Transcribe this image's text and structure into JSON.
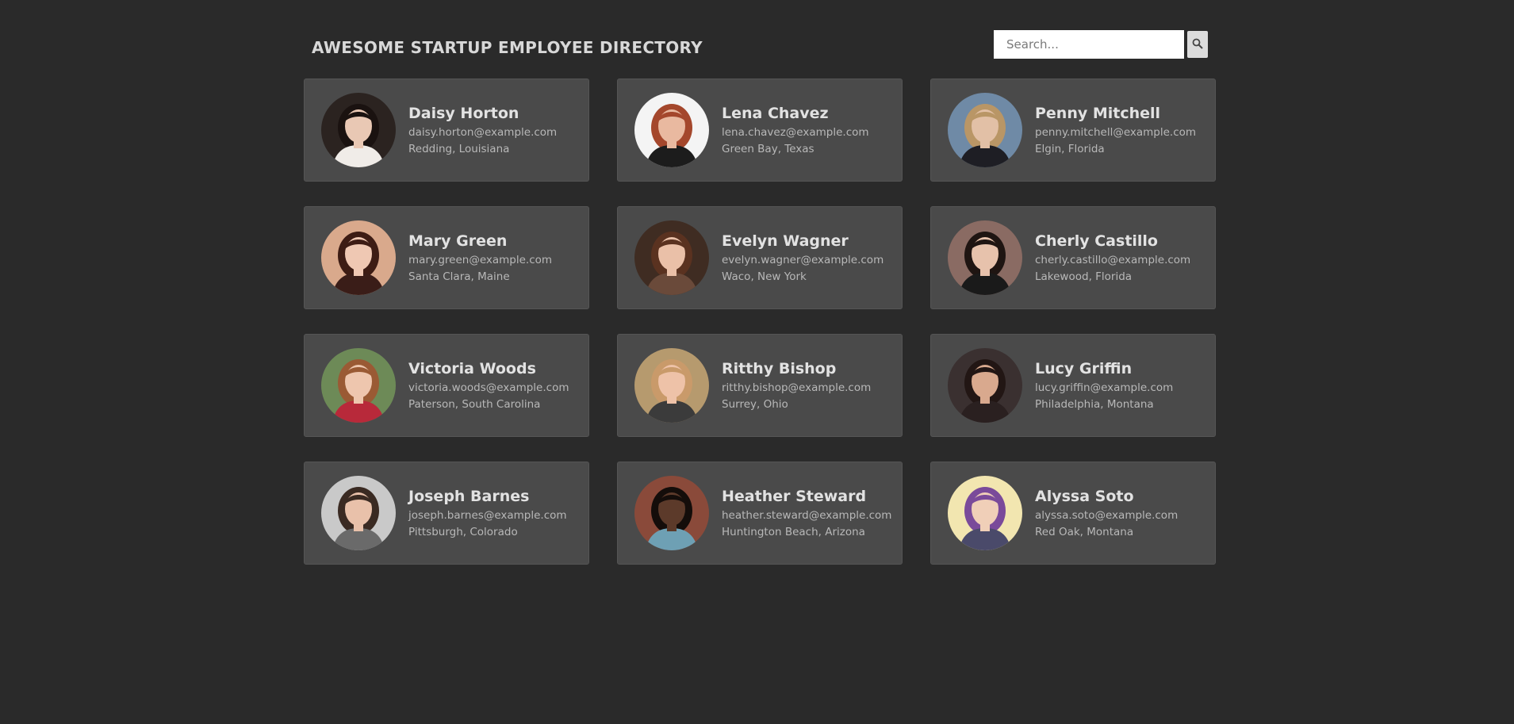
{
  "header": {
    "title": "AWESOME STARTUP EMPLOYEE DIRECTORY",
    "search_placeholder": "Search...",
    "search_icon": "magnifier-icon"
  },
  "employees": [
    {
      "name": "Daisy Horton",
      "email": "daisy.horton@example.com",
      "location": "Redding, Louisiana",
      "bg": "#2b2320",
      "skin": "#e9c8b4",
      "hair": "#1a1210",
      "shirt": "#f0ece8"
    },
    {
      "name": "Lena Chavez",
      "email": "lena.chavez@example.com",
      "location": "Green Bay, Texas",
      "bg": "#f4f4f4",
      "skin": "#e9b9a0",
      "hair": "#a4472c",
      "shirt": "#1c1c1c"
    },
    {
      "name": "Penny Mitchell",
      "email": "penny.mitchell@example.com",
      "location": "Elgin, Florida",
      "bg": "#6f8aa6",
      "skin": "#e2c0a6",
      "hair": "#b99666",
      "shirt": "#1e1e24"
    },
    {
      "name": "Mary Green",
      "email": "mary.green@example.com",
      "location": "Santa Clara, Maine",
      "bg": "#d9a98c",
      "skin": "#efc8b3",
      "hair": "#3d1c14",
      "shirt": "#3a1d18"
    },
    {
      "name": "Evelyn Wagner",
      "email": "evelyn.wagner@example.com",
      "location": "Waco, New York",
      "bg": "#3f2c22",
      "skin": "#eac0a8",
      "hair": "#5a3220",
      "shirt": "#6a4a3a"
    },
    {
      "name": "Cherly Castillo",
      "email": "cherly.castillo@example.com",
      "location": "Lakewood, Florida",
      "bg": "#8a6b63",
      "skin": "#e7c2ac",
      "hair": "#1f1512",
      "shirt": "#1a1a1a"
    },
    {
      "name": "Victoria Woods",
      "email": "victoria.woods@example.com",
      "location": "Paterson, South Carolina",
      "bg": "#6d8a57",
      "skin": "#eec6ae",
      "hair": "#9a5a34",
      "shirt": "#b8293a"
    },
    {
      "name": "Ritthy Bishop",
      "email": "ritthy.bishop@example.com",
      "location": "Surrey, Ohio",
      "bg": "#b69a6e",
      "skin": "#eec2a8",
      "hair": "#c99a6a",
      "shirt": "#3b3b3b"
    },
    {
      "name": "Lucy Griffin",
      "email": "lucy.griffin@example.com",
      "location": "Philadelphia, Montana",
      "bg": "#3a3030",
      "skin": "#d9a98e",
      "hair": "#221614",
      "shirt": "#2a2020"
    },
    {
      "name": "Joseph Barnes",
      "email": "joseph.barnes@example.com",
      "location": "Pittsburgh, Colorado",
      "bg": "#c9c9c9",
      "skin": "#e9c1aa",
      "hair": "#3a2a22",
      "shirt": "#6a6a6a"
    },
    {
      "name": "Heather Steward",
      "email": "heather.steward@example.com",
      "location": "Huntington Beach, Arizona",
      "bg": "#8a4a3a",
      "skin": "#5c3a2a",
      "hair": "#140d0a",
      "shirt": "#6ea0b4"
    },
    {
      "name": "Alyssa Soto",
      "email": "alyssa.soto@example.com",
      "location": "Red Oak, Montana",
      "bg": "#f2e6b0",
      "skin": "#f0cfb8",
      "hair": "#7a4a9a",
      "shirt": "#4a4a6a"
    }
  ]
}
